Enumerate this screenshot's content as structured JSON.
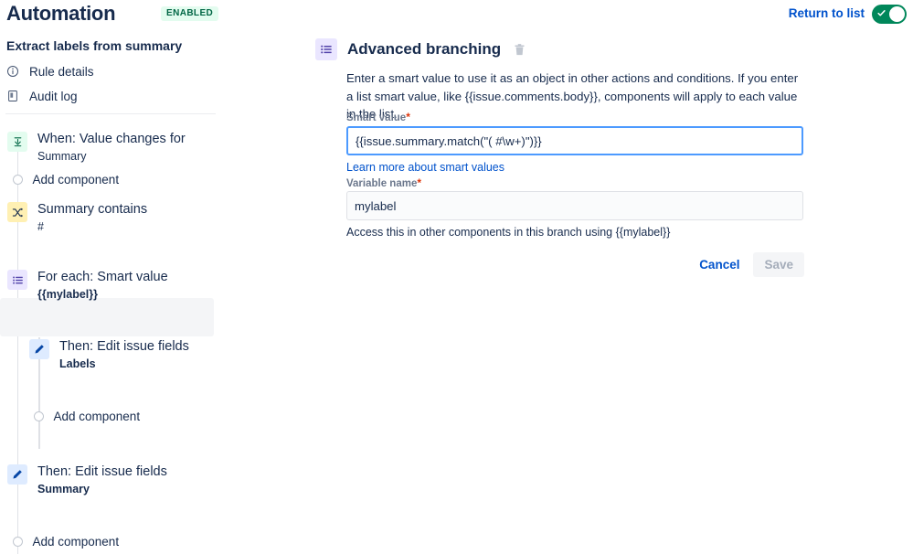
{
  "header": {
    "app_title": "Automation",
    "status_badge": "ENABLED",
    "return_link": "Return to list",
    "toggle_state": "on",
    "toggle_color": "#00875A"
  },
  "sidebar": {
    "rule_name": "Extract labels from summary",
    "nav": [
      {
        "label": "Rule details",
        "icon": "info-circle-icon"
      },
      {
        "label": "Audit log",
        "icon": "document-icon"
      }
    ],
    "steps": [
      {
        "title": "When: Value changes for",
        "subtitle": "Summary",
        "subtitle_bold": false,
        "icon": "trigger-download-icon",
        "icon_tint": "green",
        "selected": false
      },
      {
        "title": "Summary contains",
        "subtitle": "#",
        "subtitle_bold": false,
        "icon": "condition-shuffle-icon",
        "icon_tint": "yellow",
        "selected": false
      },
      {
        "title": "For each: Smart value",
        "subtitle": "{{mylabel}}",
        "subtitle_bold": true,
        "icon": "branch-list-icon",
        "icon_tint": "purple",
        "selected": true
      },
      {
        "title": "Then: Edit issue fields",
        "subtitle": "Labels",
        "subtitle_bold": true,
        "icon": "edit-pencil-icon",
        "icon_tint": "blue",
        "selected": false
      },
      {
        "title": "Then: Edit issue fields",
        "subtitle": "Summary",
        "subtitle_bold": true,
        "icon": "edit-pencil-icon",
        "icon_tint": "blue",
        "selected": false
      }
    ],
    "add_component_label": "Add component"
  },
  "main": {
    "title": "Advanced branching",
    "title_icon": "branch-list-icon",
    "delete_icon": "trash-icon",
    "description": "Enter a smart value to use it as an object in other actions and conditions. If you enter a list smart value, like {{issue.comments.body}}, components will apply to each value in the list.",
    "smart_value": {
      "label": "Smart value",
      "required": true,
      "value": "{{issue.summary.match(\"( #\\w+)\")}}",
      "placeholder": "",
      "focused": true,
      "helper_link": "Learn more about smart values"
    },
    "variable_name": {
      "label": "Variable name",
      "required": true,
      "value": "mylabel",
      "placeholder": "",
      "focused": false,
      "helper_text": "Access this in other components in this branch using {{mylabel}}"
    },
    "buttons": {
      "cancel": "Cancel",
      "save": "Save",
      "save_disabled": true
    }
  }
}
